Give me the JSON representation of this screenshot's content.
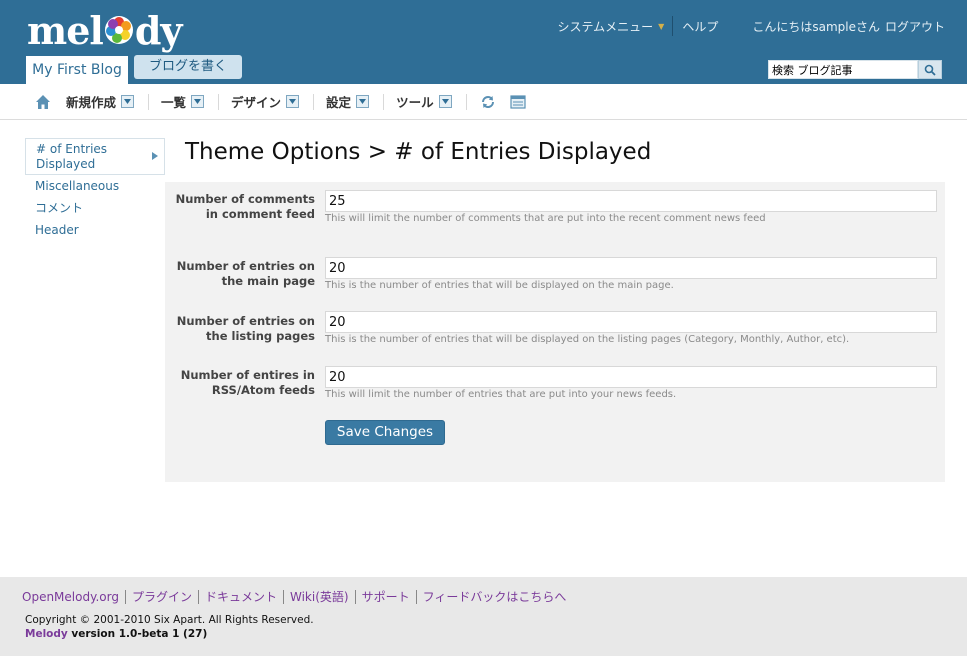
{
  "header": {
    "logo_text_left": "mel",
    "logo_text_right": "dy",
    "system_menu": "システムメニュー",
    "help": "ヘルプ",
    "greeting": "こんにちはsampleさん",
    "logout": "ログアウト",
    "blog_tab": "My First Blog",
    "write_button": "ブログを書く",
    "search_value": "検索 ブログ記事"
  },
  "menu": {
    "items": [
      "新規作成",
      "一覧",
      "デザイン",
      "設定",
      "ツール"
    ]
  },
  "sidebar": {
    "active": "# of Entries Displayed",
    "items": [
      "Miscellaneous",
      "コメント",
      "Header"
    ]
  },
  "main": {
    "title": "Theme Options > # of Entries Displayed",
    "fields": [
      {
        "label": "Number of comments in comment feed",
        "value": "25",
        "hint": "This will limit the number of comments that are put into the recent comment news feed"
      },
      {
        "label": "Number of entries on the main page",
        "value": "20",
        "hint": "This is the number of entries that will be displayed on the main page."
      },
      {
        "label": "Number of entries on the listing pages",
        "value": "20",
        "hint": "This is the number of entries that will be displayed on the listing pages (Category, Monthly, Author, etc)."
      },
      {
        "label": "Number of entires in RSS/Atom feeds",
        "value": "20",
        "hint": "This will limit the number of entries that are put into your news feeds."
      }
    ],
    "save_label": "Save Changes"
  },
  "footer": {
    "links": [
      "OpenMelody.org",
      "プラグイン",
      "ドキュメント",
      "Wiki(英語)",
      "サポート",
      "フィードバックはこちらへ"
    ],
    "copyright": "Copyright © 2001-2010 Six Apart. All Rights Reserved.",
    "version_brand": "Melody",
    "version_text": " version 1.0-beta 1 (27)"
  },
  "colors": {
    "header_bg": "#2f6e96",
    "link": "#2f6e96",
    "footer_link": "#7a3a9a",
    "panel_bg": "#f2f2f2"
  }
}
